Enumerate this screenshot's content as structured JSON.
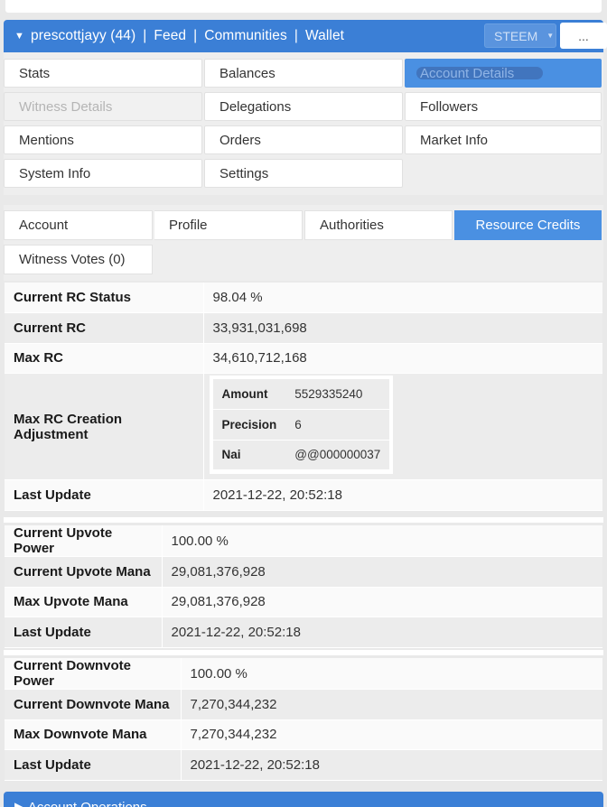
{
  "navbar": {
    "user": "prescottjayy (44)",
    "links": [
      "Feed",
      "Communities",
      "Wallet"
    ],
    "separator": "|",
    "network_select": "STEEM",
    "more_label": "..."
  },
  "menu": {
    "items": [
      {
        "label": "Stats",
        "state": "normal"
      },
      {
        "label": "Balances",
        "state": "normal"
      },
      {
        "label": "Account Details",
        "state": "active"
      },
      {
        "label": "Witness Details",
        "state": "disabled"
      },
      {
        "label": "Delegations",
        "state": "normal"
      },
      {
        "label": "Followers",
        "state": "normal"
      },
      {
        "label": "Mentions",
        "state": "normal"
      },
      {
        "label": "Orders",
        "state": "normal"
      },
      {
        "label": "Market Info",
        "state": "normal"
      },
      {
        "label": "System Info",
        "state": "normal"
      },
      {
        "label": "Settings",
        "state": "normal"
      }
    ]
  },
  "tabs": {
    "items": [
      {
        "label": "Account"
      },
      {
        "label": "Profile"
      },
      {
        "label": "Authorities"
      },
      {
        "label": "Resource Credits"
      },
      {
        "label": "Witness Votes (0)"
      }
    ]
  },
  "rc": {
    "status_label": "Current RC Status",
    "status_value": "98.04 %",
    "current_label": "Current RC",
    "current_value": "33,931,031,698",
    "max_label": "Max RC",
    "max_value": "34,610,712,168",
    "adj_label": "Max RC Creation Adjustment",
    "adj": {
      "amount_label": "Amount",
      "amount_value": "5529335240",
      "precision_label": "Precision",
      "precision_value": "6",
      "nai_label": "Nai",
      "nai_value": "@@000000037"
    },
    "update_label": "Last Update",
    "update_value": "2021-12-22, 20:52:18"
  },
  "upvote": {
    "power_label": "Current Upvote Power",
    "power_value": "100.00 %",
    "mana_label": "Current Upvote Mana",
    "mana_value": "29,081,376,928",
    "max_label": "Max Upvote Mana",
    "max_value": "29,081,376,928",
    "update_label": "Last Update",
    "update_value": "2021-12-22, 20:52:18"
  },
  "downvote": {
    "power_label": "Current Downvote Power",
    "power_value": "100.00 %",
    "mana_label": "Current Downvote Mana",
    "mana_value": "7,270,344,232",
    "max_label": "Max Downvote Mana",
    "max_value": "7,270,344,232",
    "update_label": "Last Update",
    "update_value": "2021-12-22, 20:52:18"
  },
  "bottom": {
    "section_label": "Account Operations"
  },
  "colors": {
    "primary": "#3b7fd6",
    "active_button": "#4a90e2"
  }
}
